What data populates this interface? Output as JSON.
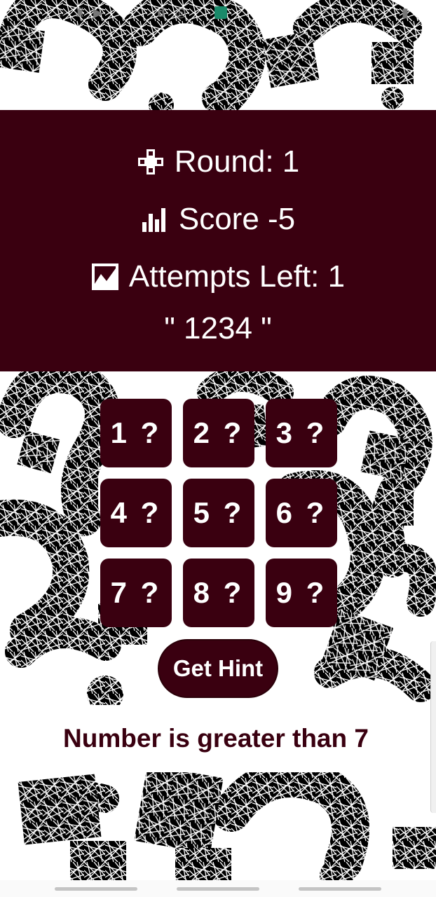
{
  "status_bar": {
    "icons": [
      "whatsapp-icon",
      "bag-icon",
      "youtube-icon",
      "d-app-icon",
      "instagram-icon",
      "app-icon",
      "wifi-icon",
      "battery-icon"
    ]
  },
  "stats": {
    "round": "Round: 1",
    "score": "Score -5",
    "attempts": "Attempts Left: 1",
    "guess": "\" 1234 \"",
    "icons": {
      "round": "gamepad-icon",
      "score": "bar-chart-icon",
      "attempts": "trend-chart-icon"
    }
  },
  "tiles": [
    "1 ?",
    "2 ?",
    "3 ?",
    "4 ?",
    "5 ?",
    "6 ?",
    "7 ?",
    "8 ?",
    "9 ?"
  ],
  "hint_button": "Get Hint",
  "message": "Number is greater than 7",
  "colors": {
    "primary": "#3a0010",
    "text_light": "#ffffff",
    "background": "#ffffff"
  }
}
